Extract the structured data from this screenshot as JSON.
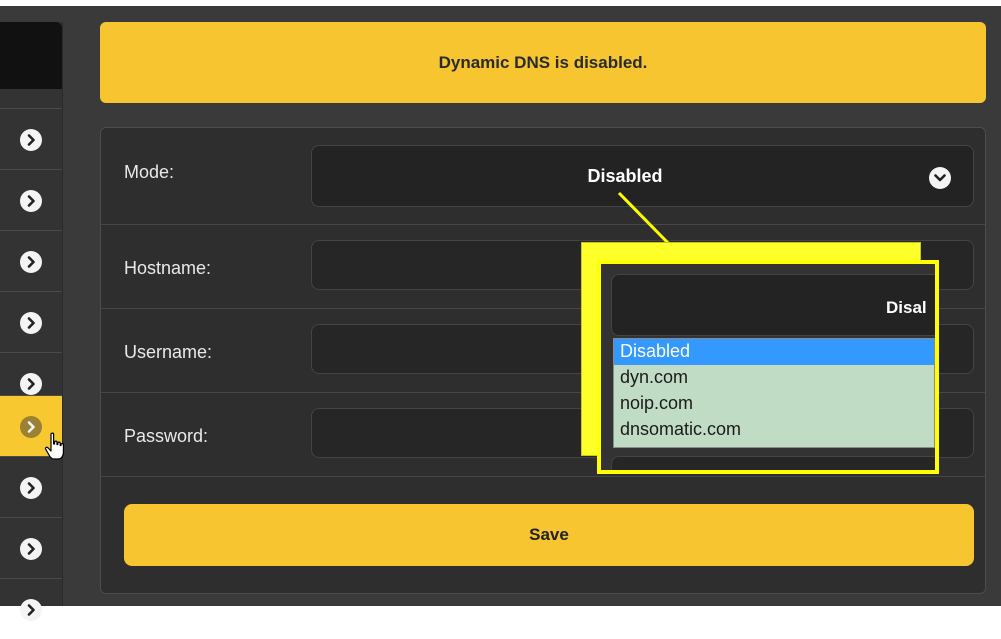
{
  "banner": {
    "message": "Dynamic DNS is disabled."
  },
  "form": {
    "mode": {
      "label": "Mode:",
      "value": "Disabled"
    },
    "hostname": {
      "label": "Hostname:",
      "value": ""
    },
    "username": {
      "label": "Username:",
      "value": ""
    },
    "password": {
      "label": "Password:",
      "value": ""
    },
    "save_label": "Save"
  },
  "callout": {
    "zoom_value": "Disal",
    "options": [
      "Disabled",
      "dyn.com",
      "noip.com",
      "dnsomatic.com"
    ],
    "selected_option": "Disabled"
  },
  "sidebar": {
    "item_count": 9,
    "active_item_index": 6,
    "icon": "chevron-right-icon"
  },
  "colors": {
    "accent": "#f7c52f",
    "callout_highlight": "#ffff00",
    "selected_option": "#3399ff",
    "list_background": "#c1dcc4"
  }
}
